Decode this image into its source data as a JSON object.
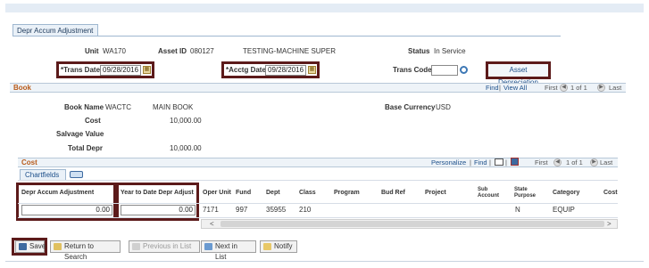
{
  "tab": {
    "label": "Depr Accum Adjustment"
  },
  "header": {
    "unit_label": "Unit",
    "unit_value": "WA170",
    "asset_id_label": "Asset ID",
    "asset_id_value": "080127",
    "asset_desc": "TESTING-MACHINE SUPER",
    "status_label": "Status",
    "status_value": "In Service",
    "trans_date_label": "*Trans Date",
    "trans_date_value": "09/28/2016",
    "acctg_date_label": "*Acctg Date",
    "acctg_date_value": "09/28/2016",
    "trans_code_label": "Trans Code",
    "trans_code_value": "",
    "asset_depreciation_button": "Asset Depreciation"
  },
  "book": {
    "title": "Book",
    "nav": {
      "find": "Find",
      "view_all": "View All",
      "first": "First",
      "range": "1 of 1",
      "last": "Last"
    },
    "book_name_label": "Book Name",
    "book_name_value": "WACTC",
    "book_desc": "MAIN BOOK",
    "base_currency_label": "Base Currency",
    "base_currency_value": "USD",
    "cost_label": "Cost",
    "cost_value": "10,000.00",
    "salvage_label": "Salvage Value",
    "salvage_value": "",
    "total_depr_label": "Total Depr",
    "total_depr_value": "10,000.00"
  },
  "cost": {
    "title": "Cost",
    "tab_label": "Chartfields",
    "nav": {
      "personalize": "Personalize",
      "find": "Find",
      "first": "First",
      "range": "1 of 1",
      "last": "Last"
    },
    "columns": [
      "Depr Accum Adjustment",
      "Year to Date Depr Adjust",
      "Oper Unit",
      "Fund",
      "Dept",
      "Class",
      "Program",
      "Bud Ref",
      "Project",
      "Sub Account",
      "State Purpose",
      "Category",
      "Cost"
    ],
    "row": {
      "depr_accum_adjustment": "0.00",
      "ytd_depr_adjust": "0.00",
      "oper_unit": "7171",
      "fund": "997",
      "dept": "35955",
      "class": "210",
      "program": "",
      "bud_ref": "",
      "project": "",
      "sub_account": "",
      "state_purpose": "N",
      "category": "EQUIP",
      "cost": ""
    }
  },
  "buttons": {
    "save": "Save",
    "return_to_search": "Return to Search",
    "previous_in_list": "Previous in List",
    "next_in_list": "Next in List",
    "notify": "Notify"
  },
  "colors": {
    "highlight": "#5c1a1a",
    "section_title": "#b75a1a",
    "link": "#1c4f8a"
  }
}
